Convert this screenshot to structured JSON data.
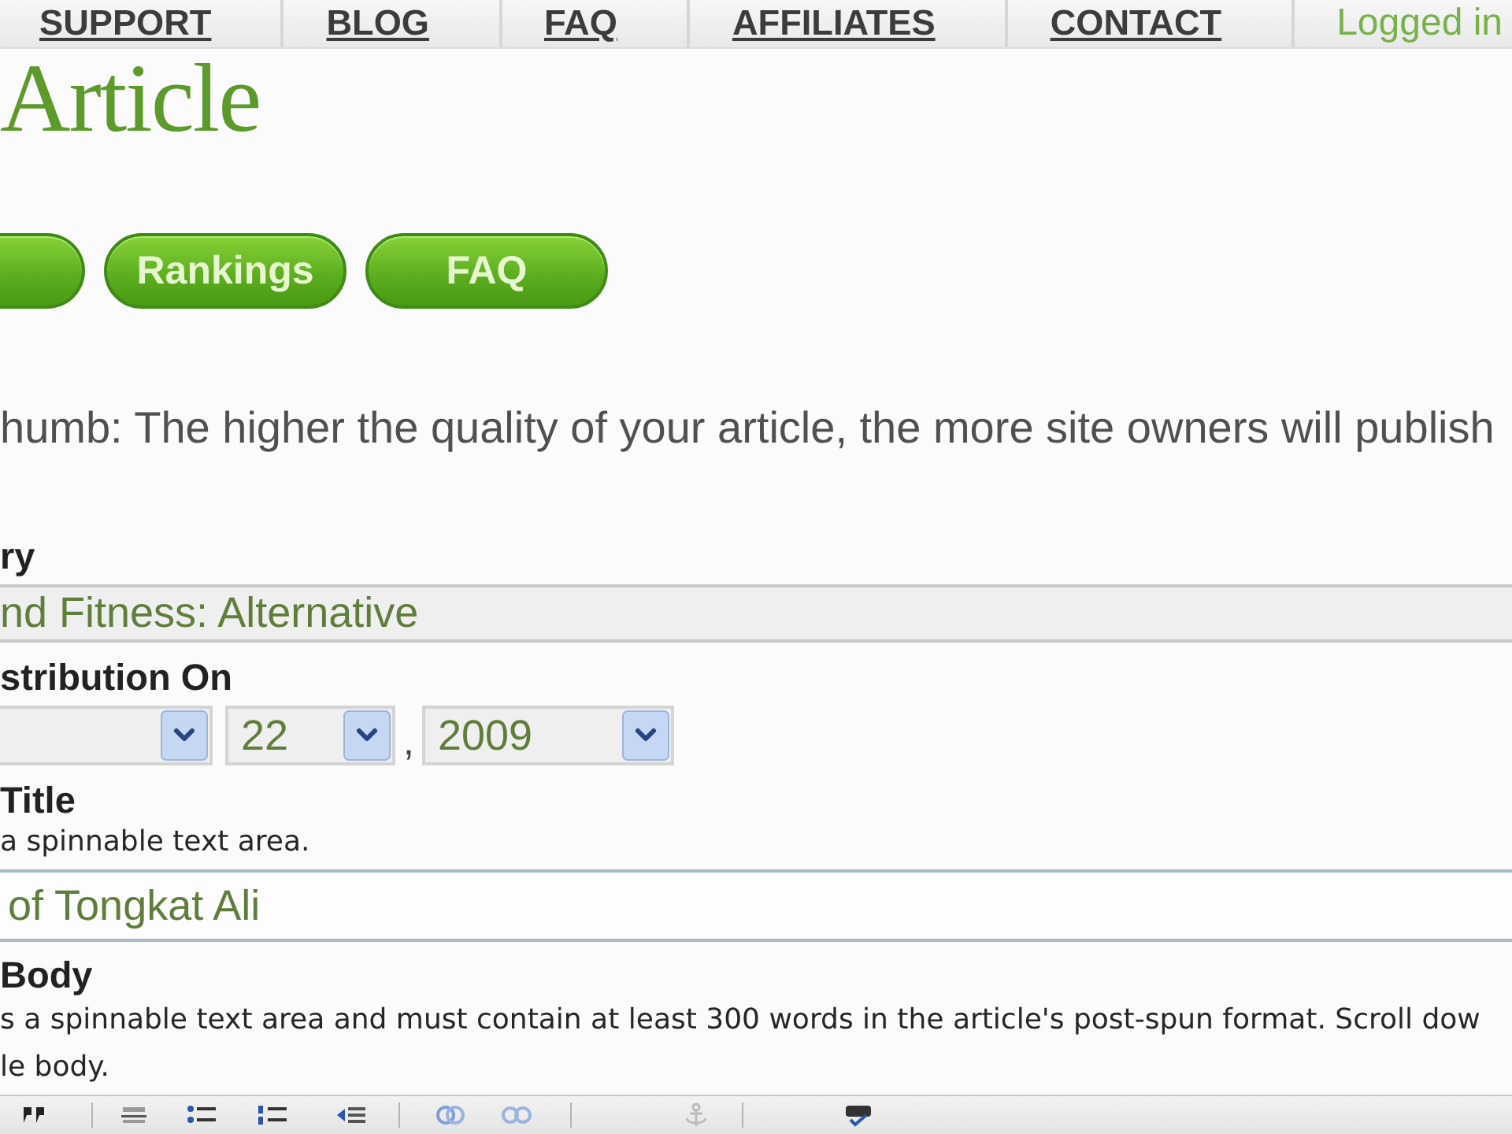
{
  "nav": {
    "items": [
      {
        "label": "SUPPORT"
      },
      {
        "label": "BLOG"
      },
      {
        "label": "FAQ"
      },
      {
        "label": "AFFILIATES"
      },
      {
        "label": "CONTACT"
      }
    ],
    "status": "Logged in"
  },
  "page_title": "Article",
  "buttons": [
    {
      "kind": "cut"
    },
    {
      "kind": "labelled",
      "label": "Rankings"
    },
    {
      "kind": "labelled",
      "label": "FAQ"
    }
  ],
  "hint": "humb: The higher the quality of your article, the more site owners will publish",
  "form": {
    "fields": [
      {
        "kind": "select",
        "label": "ry",
        "value": "nd Fitness: Alternative"
      },
      {
        "kind": "date",
        "label": "stribution On",
        "parts": [
          {
            "kind": "month"
          },
          {
            "kind": "day",
            "value": "22"
          },
          {
            "kind": "year",
            "value": "2009"
          }
        ],
        "separator": ","
      },
      {
        "kind": "text",
        "label": "Title",
        "help": [
          "a spinnable text area."
        ],
        "value": "of Tongkat Ali"
      },
      {
        "kind": "editor",
        "label": "Body",
        "help": [
          "s a spinnable text area and must contain at least 300 words in the article's post-spun format. Scroll dow",
          "le body."
        ]
      }
    ]
  }
}
